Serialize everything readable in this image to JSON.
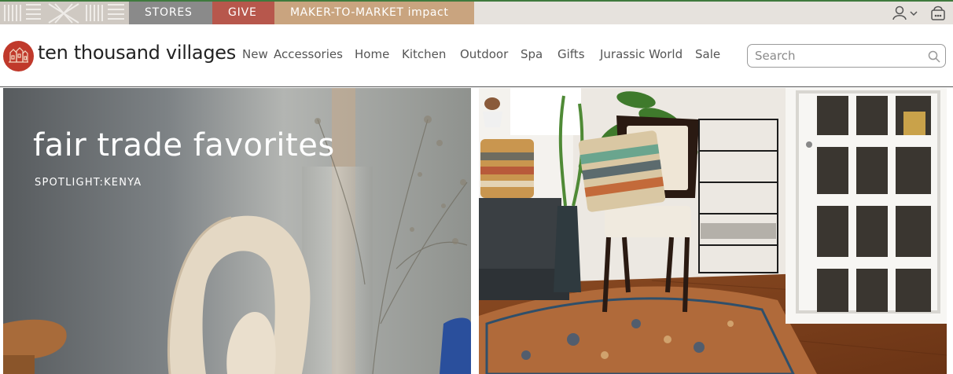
{
  "topbar": {
    "stores_label": "STORES",
    "give_label": "GIVE",
    "maker_label": "MAKER-TO-MARKET impact",
    "account_icon": "user-icon",
    "cart_icon": "basket-icon"
  },
  "header": {
    "brand_name": "ten thousand villages",
    "logo_icon": "village-logo-icon",
    "nav_items": [
      "New",
      "Accessories",
      "Home",
      "Kitchen",
      "Outdoor",
      "Spa",
      "Gifts",
      "Jurassic World",
      "Sale"
    ],
    "search_placeholder": "Search",
    "search_icon": "magnifier-icon"
  },
  "hero": {
    "left_title": "fair trade favorites",
    "left_subtitle": "SPOTLIGHT:KENYA"
  },
  "colors": {
    "stores_bg": "#8a8a8a",
    "give_bg": "#b7574c",
    "maker_bg": "#c9a47f",
    "logo_red": "#c0392b",
    "topbar_bg": "#e6e2dd"
  }
}
